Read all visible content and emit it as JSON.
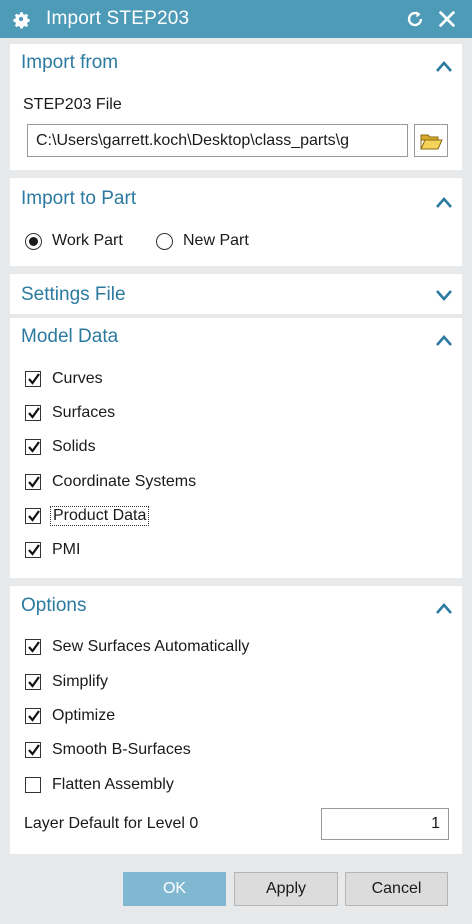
{
  "window": {
    "title": "Import STEP203",
    "icons": [
      "gear-icon",
      "reset-icon",
      "close-icon"
    ]
  },
  "import_from": {
    "title": "Import from",
    "file_label": "STEP203 File",
    "file_value": "C:\\Users\\garrett.koch\\Desktop\\class_parts\\g",
    "browse_icon": "folder-open-icon",
    "collapsed": false
  },
  "import_to_part": {
    "title": "Import to Part",
    "options": [
      {
        "label": "Work Part",
        "selected": true
      },
      {
        "label": "New Part",
        "selected": false
      }
    ],
    "collapsed": false
  },
  "settings_file": {
    "title": "Settings File",
    "collapsed": true
  },
  "model_data": {
    "title": "Model Data",
    "collapsed": false,
    "items": [
      {
        "label": "Curves",
        "checked": true
      },
      {
        "label": "Surfaces",
        "checked": true
      },
      {
        "label": "Solids",
        "checked": true
      },
      {
        "label": "Coordinate Systems",
        "checked": true
      },
      {
        "label": "Product Data",
        "checked": true
      },
      {
        "label": "PMI",
        "checked": true
      }
    ]
  },
  "options": {
    "title": "Options",
    "collapsed": false,
    "items": [
      {
        "label": "Sew Surfaces Automatically",
        "checked": true
      },
      {
        "label": "Simplify",
        "checked": true
      },
      {
        "label": "Optimize",
        "checked": true
      },
      {
        "label": "Smooth B-Surfaces",
        "checked": true
      },
      {
        "label": "Flatten Assembly",
        "checked": false
      }
    ],
    "layer_label": "Layer Default for Level 0",
    "layer_value": "1"
  },
  "buttons": {
    "ok": "OK",
    "apply": "Apply",
    "cancel": "Cancel"
  },
  "colors": {
    "titlebar": "#4e9bb8",
    "section_title": "#2c7aa0",
    "ok_button": "#80b8d2"
  }
}
